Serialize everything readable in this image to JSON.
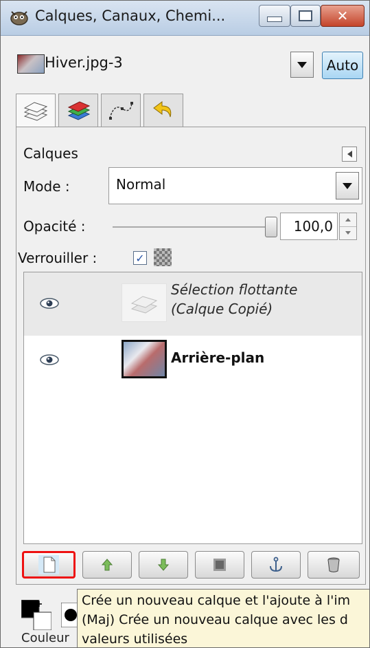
{
  "window": {
    "title": "Calques, Canaux, Chemi..."
  },
  "image_selector": {
    "value": "Hiver.jpg-3",
    "auto_label": "Auto"
  },
  "tabs": [
    {
      "name": "layers-tab",
      "icon": "layers-stack-icon"
    },
    {
      "name": "channels-tab",
      "icon": "channels-icon"
    },
    {
      "name": "paths-tab",
      "icon": "paths-icon"
    },
    {
      "name": "undo-history-tab",
      "icon": "undo-icon"
    }
  ],
  "panel": {
    "title": "Calques",
    "mode_label": "Mode :",
    "mode_value": "Normal",
    "opacity_label": "Opacité :",
    "opacity_value": "100,0",
    "opacity_fraction": 1.0,
    "lock_label": "Verrouiller :",
    "lock_pixels_checked": true
  },
  "layers": [
    {
      "line1": "Sélection flottante",
      "line2": "(Calque Copié)",
      "visible": true,
      "style": "italic"
    },
    {
      "line1": "Arrière-plan",
      "visible": true,
      "style": "bold"
    }
  ],
  "bottom_buttons": [
    {
      "name": "new-layer-button",
      "icon": "new-layer-icon",
      "highlighted": true
    },
    {
      "name": "raise-layer-button",
      "icon": "arrow-up-icon"
    },
    {
      "name": "lower-layer-button",
      "icon": "arrow-down-icon"
    },
    {
      "name": "duplicate-layer-button",
      "icon": "duplicate-icon"
    },
    {
      "name": "anchor-layer-button",
      "icon": "anchor-icon"
    },
    {
      "name": "delete-layer-button",
      "icon": "trash-icon"
    }
  ],
  "tooltip": {
    "line1": "Crée un nouveau calque et l'ajoute à l'im",
    "line2": "(Maj)  Crée un nouveau calque avec les d",
    "line3": "valeurs utilisées"
  },
  "bottom": {
    "color_label": "Couleur"
  },
  "colors": {
    "highlight": "#e11111",
    "title_bar": "#c9d9ec",
    "tooltip_bg": "#fbf6d8",
    "auto_button": "#bfe2f7"
  }
}
